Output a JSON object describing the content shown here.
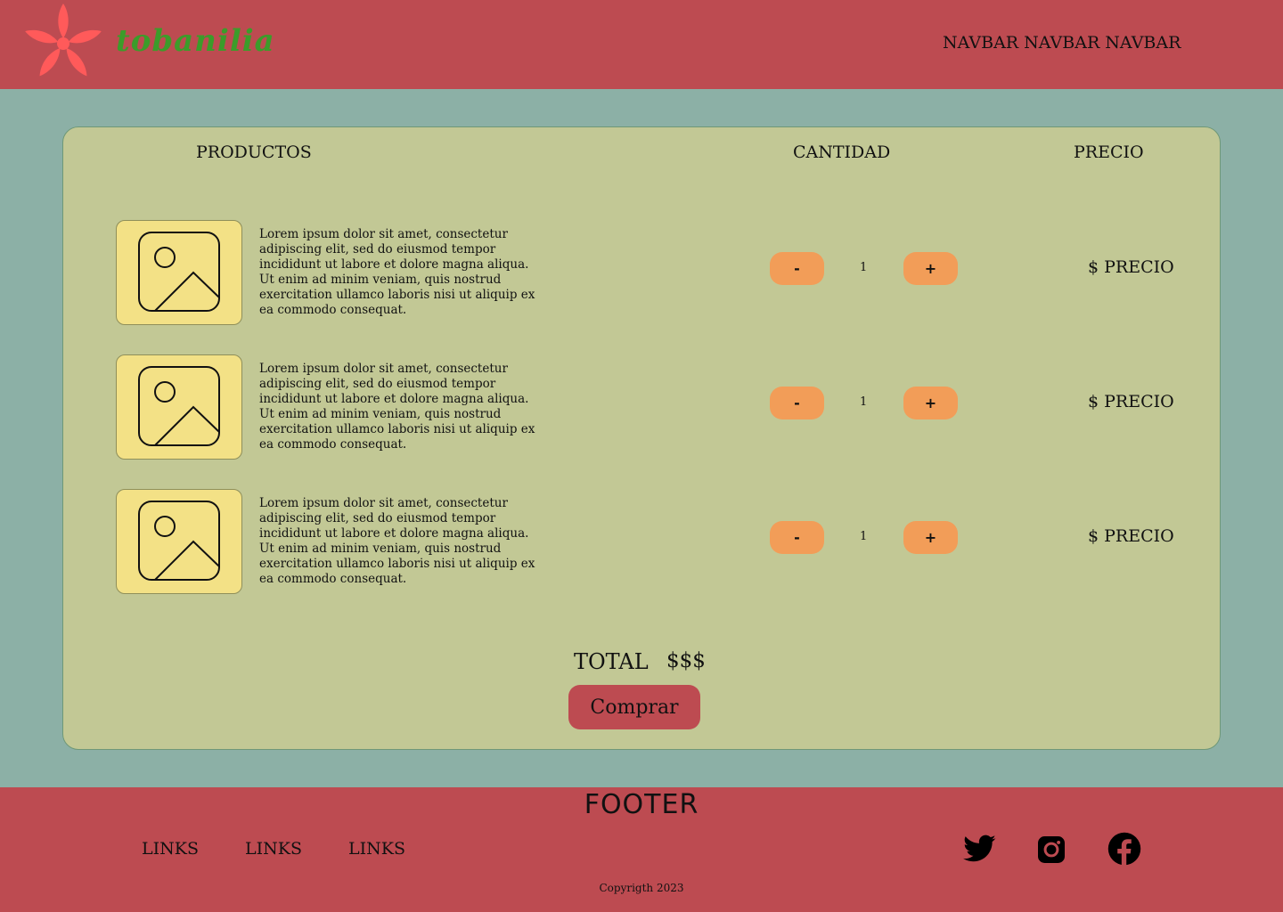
{
  "header": {
    "logo_text": "tobanilia",
    "nav_text": "NAVBAR NAVBAR NAVBAR",
    "logo_color": "#ff5a5a"
  },
  "cart": {
    "headers": {
      "products": "PRODUCTOS",
      "quantity": "CANTIDAD",
      "price": "PRECIO"
    },
    "items": [
      {
        "image_icon": "image-placeholder-icon",
        "description": "Lorem ipsum dolor sit amet, consectetur adipiscing elit, sed do eiusmod tempor incididunt ut labore et dolore magna aliqua. Ut enim ad minim veniam, quis nostrud exercitation ullamco laboris nisi ut aliquip ex ea commodo consequat.",
        "minus_label": "-",
        "quantity": "1",
        "plus_label": "+",
        "price": "$ PRECIO"
      },
      {
        "image_icon": "image-placeholder-icon",
        "description": "Lorem ipsum dolor sit amet, consectetur adipiscing elit, sed do eiusmod tempor incididunt ut labore et dolore magna aliqua. Ut enim ad minim veniam, quis nostrud exercitation ullamco laboris nisi ut aliquip ex ea commodo consequat.",
        "minus_label": "-",
        "quantity": "1",
        "plus_label": "+",
        "price": "$ PRECIO"
      },
      {
        "image_icon": "image-placeholder-icon",
        "description": "Lorem ipsum dolor sit amet, consectetur adipiscing elit, sed do eiusmod tempor incididunt ut labore et dolore magna aliqua. Ut enim ad minim veniam, quis nostrud exercitation ullamco laboris nisi ut aliquip ex ea commodo consequat.",
        "minus_label": "-",
        "quantity": "1",
        "plus_label": "+",
        "price": "$ PRECIO"
      }
    ],
    "total_label": "TOTAL",
    "total_value": "$$$",
    "buy_label": "Comprar"
  },
  "footer": {
    "title": "FOOTER",
    "links": [
      "LINKS",
      "LINKS",
      "LINKS"
    ],
    "social_icons": [
      "twitter-icon",
      "instagram-icon",
      "facebook-icon"
    ],
    "copyright": "Copyrigth 2023"
  },
  "colors": {
    "header_bg": "#bd4b51",
    "page_bg": "#8cb0a6",
    "card_bg": "#c2c895",
    "thumb_bg": "#f3e186",
    "qty_button": "#f29d58",
    "buy_button": "#bd4b51"
  }
}
